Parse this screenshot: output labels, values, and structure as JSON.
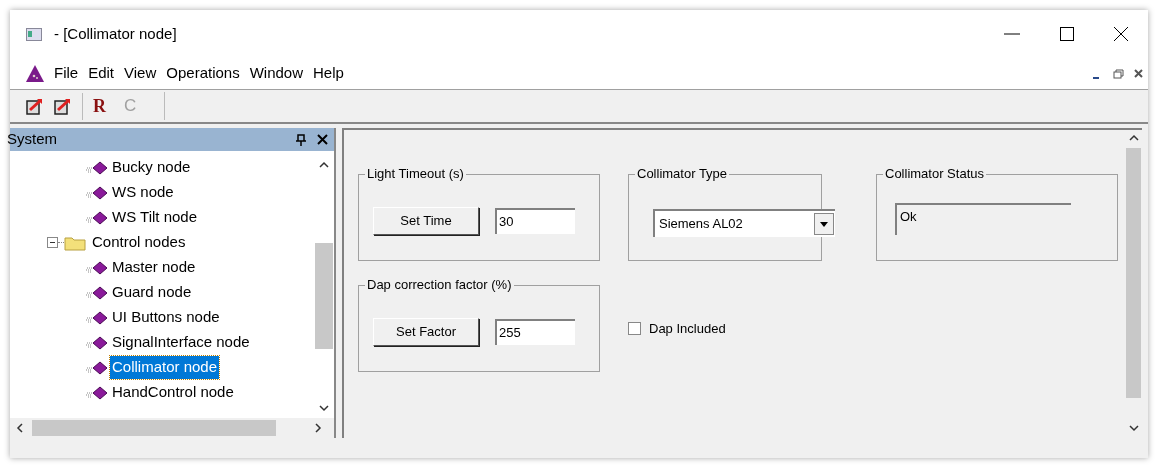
{
  "window": {
    "title": "- [Collimator node]"
  },
  "menu": [
    {
      "label": "File"
    },
    {
      "label": "Edit"
    },
    {
      "label": "View"
    },
    {
      "label": "Operations"
    },
    {
      "label": "Window"
    },
    {
      "label": "Help"
    }
  ],
  "toolbar": [
    {
      "kind": "icon",
      "disabled": false
    },
    {
      "kind": "icon",
      "disabled": false
    },
    {
      "kind": "letter",
      "label": "R",
      "disabled": false
    },
    {
      "kind": "letter",
      "label": "C",
      "disabled": true
    }
  ],
  "sidebar": {
    "title": "System",
    "items": [
      {
        "kind": "continued",
        "children": [
          {
            "kind": "node",
            "label": "Bucky node",
            "selected": false
          },
          {
            "kind": "node",
            "label": "WS node",
            "selected": false
          },
          {
            "kind": "node",
            "label": "WS Tilt node",
            "selected": false
          }
        ]
      },
      {
        "kind": "folder",
        "label": "Control nodes",
        "expanded": true,
        "children": [
          {
            "kind": "node",
            "label": "Master node",
            "selected": false
          },
          {
            "kind": "node",
            "label": "Guard node",
            "selected": false
          },
          {
            "kind": "node",
            "label": "UI Buttons node",
            "selected": false
          },
          {
            "kind": "node",
            "label": "SignalInterface node",
            "selected": false
          },
          {
            "kind": "node",
            "label": "Collimator node",
            "selected": true
          },
          {
            "kind": "node",
            "label": "HandControl node",
            "selected": false
          }
        ]
      }
    ]
  },
  "groups": [
    {
      "title": "Light Timeout (s)",
      "kind": "button_field",
      "button": "Set Time",
      "value": "30"
    },
    {
      "title": "Collimator Type",
      "kind": "select",
      "value": "Siemens AL02"
    },
    {
      "title": "Collimator Status",
      "kind": "status",
      "value": "Ok"
    },
    {
      "title": "Dap correction factor (%)",
      "kind": "button_field",
      "button": "Set Factor",
      "value": "255"
    }
  ],
  "checkbox": {
    "label": "Dap Included",
    "checked": false
  }
}
